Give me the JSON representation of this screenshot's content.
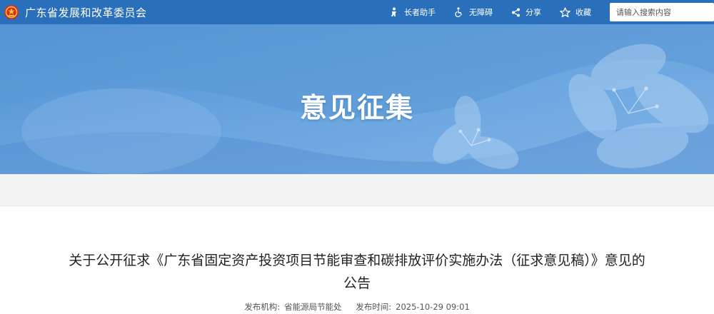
{
  "header": {
    "site_title": "广东省发展和改革委员会",
    "tools": [
      {
        "label": "长者助手",
        "icon": "elder-assistant-icon"
      },
      {
        "label": "无障碍",
        "icon": "accessibility-icon"
      },
      {
        "label": "分享",
        "icon": "share-icon"
      },
      {
        "label": "收藏",
        "icon": "star-icon"
      }
    ],
    "search_placeholder": "请输入搜索内容"
  },
  "banner": {
    "title": "意见征集"
  },
  "article": {
    "title": "关于公开征求《广东省固定资产投资项目节能审查和碳排放评价实施办法（征求意见稿）》意见的公告",
    "publisher_label": "发布机构:",
    "publisher": "省能源局节能处",
    "time_label": "发布时间:",
    "time": "2025-10-29 09:01"
  },
  "colors": {
    "topbar": "#2a6fb9",
    "banner": "#5e9bd8"
  }
}
